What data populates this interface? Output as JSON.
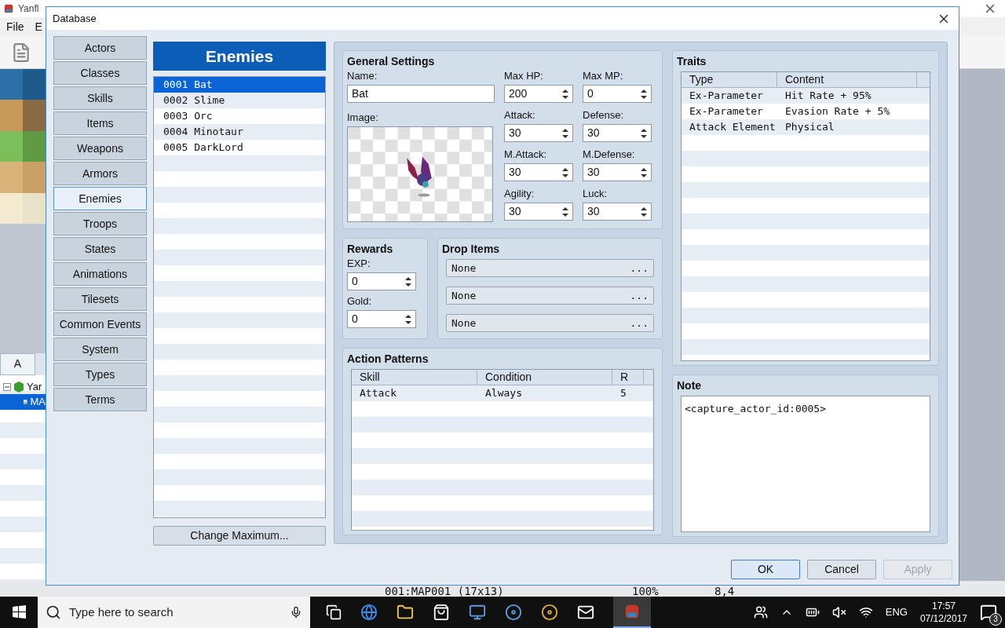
{
  "background_app": {
    "title": "Yanfl",
    "menu": [
      "File",
      "E"
    ],
    "tab": "A",
    "tree": [
      {
        "label": "Yar",
        "expanded": true,
        "children": [
          {
            "label": "MA",
            "selected": true
          }
        ]
      }
    ],
    "status_bar": [
      "001:MAP001 (17x13)",
      "100%",
      "8,4"
    ]
  },
  "dialog": {
    "title": "Database",
    "categories": [
      {
        "label": "Actors",
        "selected": false
      },
      {
        "label": "Classes",
        "selected": false
      },
      {
        "label": "Skills",
        "selected": false
      },
      {
        "label": "Items",
        "selected": false
      },
      {
        "label": "Weapons",
        "selected": false
      },
      {
        "label": "Armors",
        "selected": false
      },
      {
        "label": "Enemies",
        "selected": true
      },
      {
        "label": "Troops",
        "selected": false
      },
      {
        "label": "States",
        "selected": false
      },
      {
        "label": "Animations",
        "selected": false
      },
      {
        "label": "Tilesets",
        "selected": false
      },
      {
        "label": "Common Events",
        "selected": false
      },
      {
        "label": "System",
        "selected": false
      },
      {
        "label": "Types",
        "selected": false
      },
      {
        "label": "Terms",
        "selected": false
      }
    ],
    "list": {
      "title": "Enemies",
      "items": [
        {
          "label": "0001 Bat",
          "selected": true
        },
        {
          "label": "0002 Slime",
          "selected": false
        },
        {
          "label": "0003 Orc",
          "selected": false
        },
        {
          "label": "0004 Minotaur",
          "selected": false
        },
        {
          "label": "0005 DarkLord",
          "selected": false
        }
      ],
      "button": "Change Maximum..."
    },
    "general": {
      "title": "General Settings",
      "name": {
        "label": "Name:",
        "value": "Bat"
      },
      "image_label": "Image:",
      "stats": [
        {
          "label": "Max HP:",
          "value": "200"
        },
        {
          "label": "Max MP:",
          "value": "0"
        },
        {
          "label": "Attack:",
          "value": "30"
        },
        {
          "label": "Defense:",
          "value": "30"
        },
        {
          "label": "M.Attack:",
          "value": "30"
        },
        {
          "label": "M.Defense:",
          "value": "30"
        },
        {
          "label": "Agility:",
          "value": "30"
        },
        {
          "label": "Luck:",
          "value": "30"
        }
      ]
    },
    "rewards": {
      "title": "Rewards",
      "fields": [
        {
          "label": "EXP:",
          "value": "0"
        },
        {
          "label": "Gold:",
          "value": "0"
        }
      ]
    },
    "drop_items": {
      "title": "Drop Items",
      "items": [
        {
          "value": "None",
          "button": "..."
        },
        {
          "value": "None",
          "button": "..."
        },
        {
          "value": "None",
          "button": "..."
        }
      ]
    },
    "action_patterns": {
      "title": "Action Patterns",
      "columns": [
        "Skill",
        "Condition",
        "R"
      ],
      "rows": [
        [
          "Attack",
          "Always",
          "5"
        ]
      ]
    },
    "traits": {
      "title": "Traits",
      "columns": [
        "Type",
        "Content"
      ],
      "rows": [
        [
          "Ex-Parameter",
          "Hit Rate + 95%"
        ],
        [
          "Ex-Parameter",
          "Evasion Rate + 5%"
        ],
        [
          "Attack Element",
          "Physical"
        ]
      ]
    },
    "note": {
      "title": "Note",
      "value": "<capture_actor_id:0005>"
    },
    "buttons": [
      {
        "label": "OK",
        "disabled": false,
        "selected": true
      },
      {
        "label": "Cancel",
        "disabled": false,
        "selected": false
      },
      {
        "label": "Apply",
        "disabled": true,
        "selected": false
      }
    ]
  },
  "taskbar": {
    "search_placeholder": "Type here to search",
    "language": "ENG",
    "time": "17:57",
    "date": "07/12/2017",
    "notifications": "3"
  }
}
